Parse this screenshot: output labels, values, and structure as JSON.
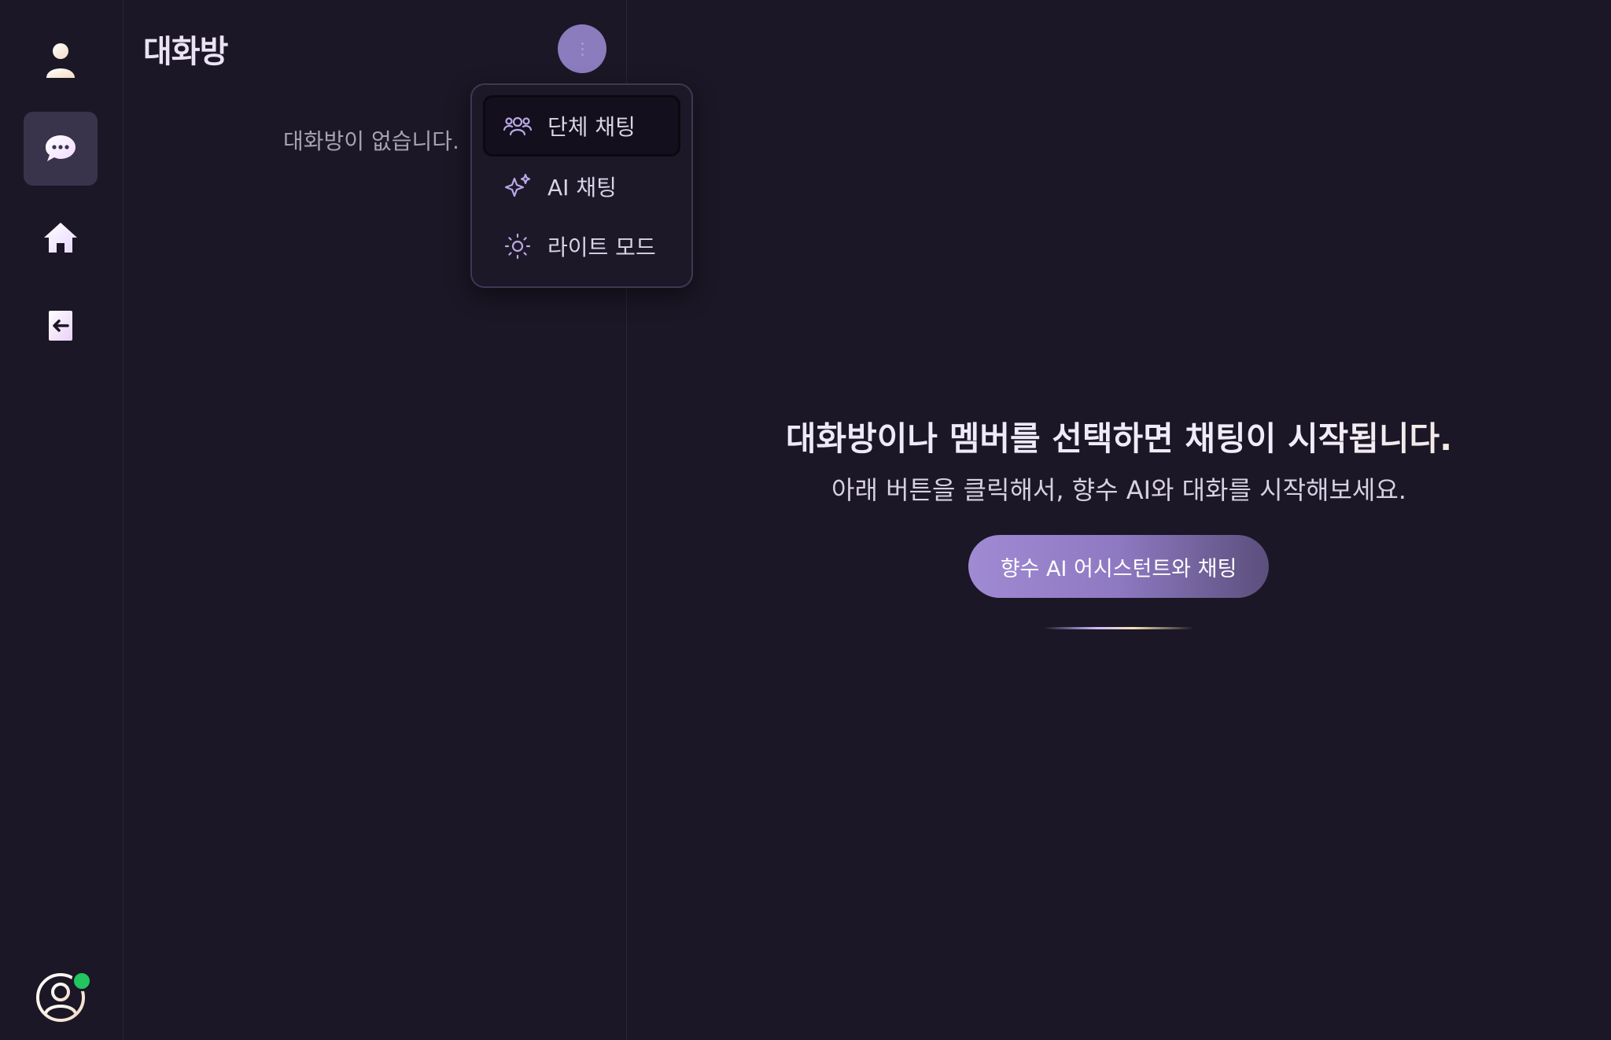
{
  "rail": {
    "items": [
      {
        "name": "profile",
        "icon": "user-icon"
      },
      {
        "name": "chat",
        "icon": "chat-bubble-icon",
        "active": true
      },
      {
        "name": "home",
        "icon": "home-icon"
      },
      {
        "name": "logout",
        "icon": "logout-icon"
      }
    ],
    "online_status_color": "#22c55e"
  },
  "room_panel": {
    "title": "대화방",
    "empty_text": "대화방이 없습니다."
  },
  "dropdown": {
    "items": [
      {
        "label": "단체 채팅",
        "icon": "group-users-icon"
      },
      {
        "label": "AI 채팅",
        "icon": "sparkle-icon"
      },
      {
        "label": "라이트 모드",
        "icon": "sun-icon"
      }
    ]
  },
  "main": {
    "heading": "대화방이나 멤버를 선택하면 채팅이 시작됩니다.",
    "subheading": "아래 버튼을 클릭해서, 향수 AI와 대화를 시작해보세요.",
    "cta_label": "향수 AI 어시스턴트와 채팅"
  },
  "colors": {
    "background": "#1b1726",
    "accent": "#8b7cbd",
    "cta_gradient_start": "#a08ad3",
    "cta_gradient_end": "#5b4f7c"
  }
}
